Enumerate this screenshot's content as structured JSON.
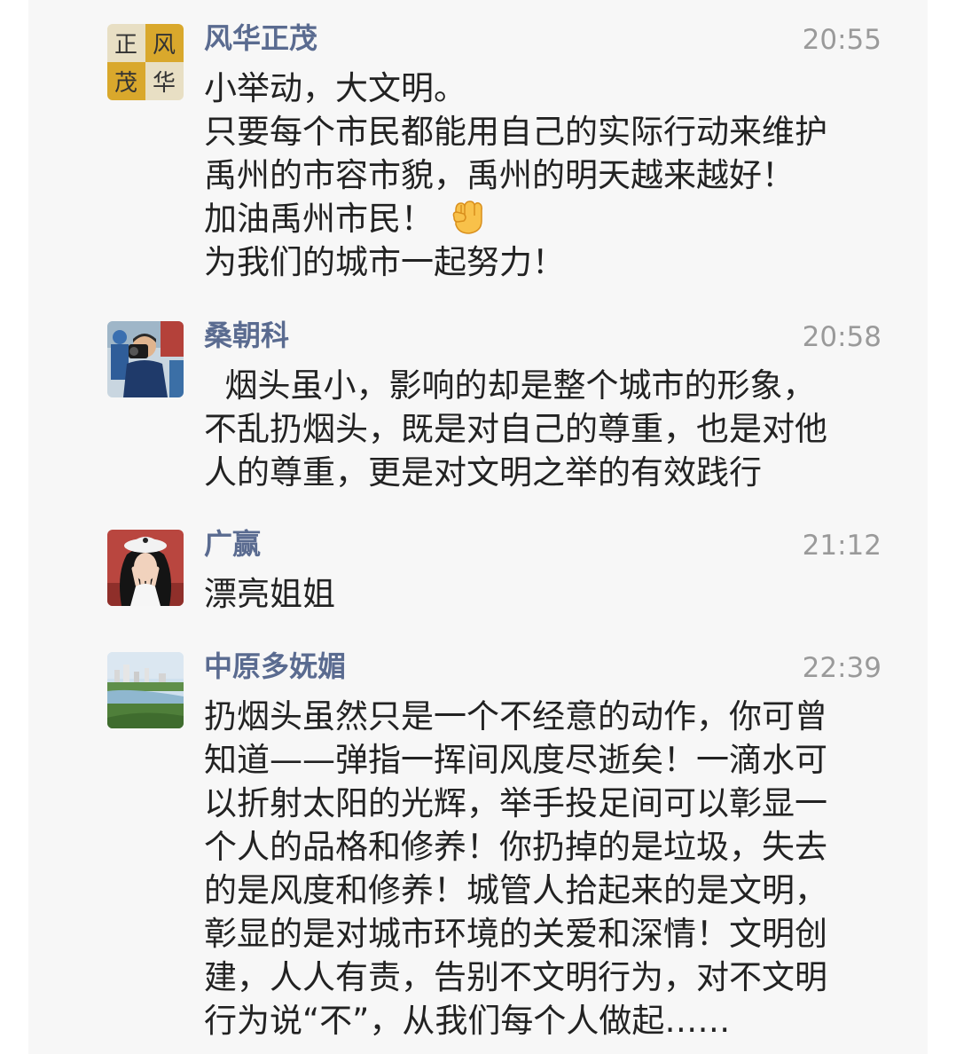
{
  "comments": [
    {
      "name": "风华正茂",
      "time": "20:55",
      "avatar_icon": "calligraphy-avatar-icon",
      "lines": [
        "小举动，大文明。",
        "只要每个市民都能用自己的实际行动来维护",
        "禹州的市容市貌，禹州的明天越来越好！",
        "加油禹州市民！",
        "为我们的城市一起努力！"
      ],
      "avatar_text": [
        "正",
        "风",
        "茂",
        "华"
      ]
    },
    {
      "name": "桑朝科",
      "time": "20:58",
      "avatar_icon": "photographer-avatar-icon",
      "lines": [
        "  烟头虽小，影响的却是整个城市的形象，",
        "不乱扔烟头，既是对自己的尊重，也是对他",
        "人的尊重，更是对文明之举的有效践行"
      ]
    },
    {
      "name": "广赢",
      "time": "21:12",
      "avatar_icon": "girl-avatar-icon",
      "lines": [
        "漂亮姐姐"
      ]
    },
    {
      "name": "中原多妩媚",
      "time": "22:39",
      "avatar_icon": "cityscape-avatar-icon",
      "lines": [
        "扔烟头虽然只是一个不经意的动作，你可曾",
        "知道——弹指一挥间风度尽逝矣！一滴水可",
        "以折射太阳的光辉，举手投足间可以彰显一",
        "个人的品格和修养！你扔掉的是垃圾，失去",
        "的是风度和修养！城管人拾起来的是文明，",
        "彰显的是对城市环境的关爱和深情！文明创",
        "建，人人有责，告别不文明行为，对不文明",
        "行为说“不”，从我们每个人做起……"
      ]
    }
  ],
  "colors": {
    "name": "#5a6b90",
    "time": "#9a9a9a",
    "text": "#222222",
    "panel_bg": "#f7f7f7"
  },
  "emoji_icon": "raised-fist-icon"
}
